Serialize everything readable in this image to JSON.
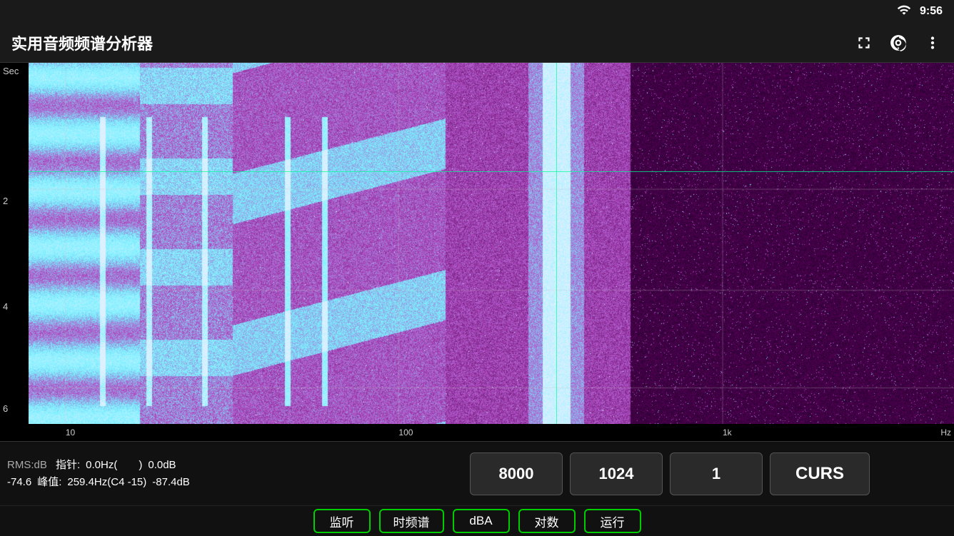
{
  "statusBar": {
    "time": "9:56"
  },
  "appBar": {
    "title": "实用音频频谱分析器",
    "icons": [
      "fullscreen",
      "target",
      "more-vert"
    ]
  },
  "spectrogram": {
    "yAxisLabel": "Sec",
    "yLabels": [
      {
        "value": "2",
        "topPercent": 36
      },
      {
        "value": "4",
        "topPercent": 64
      },
      {
        "value": "6",
        "topPercent": 91
      }
    ],
    "xLabels": [
      {
        "value": "10",
        "leftPercent": 4
      },
      {
        "value": "100",
        "leftPercent": 40
      },
      {
        "value": "1k",
        "leftPercent": 75
      },
      {
        "value": "Hz",
        "leftPercent": 96
      }
    ],
    "hLineTopPercent": 30,
    "vLineLeftPercent": 57
  },
  "infoBar": {
    "rmsLabel": "RMS:dB",
    "rmsValue": "-74.6",
    "pointerLabel": "指针:",
    "pointerFreq": "0.0Hz(",
    "pointerFreqSuffix": ")",
    "pointerDB": "0.0dB",
    "peakLabel": "峰值:",
    "peakFreq": "259.4Hz(C4 -15)",
    "peakDB": "-87.4dB",
    "buttons": {
      "btn1": "8000",
      "btn2": "1024",
      "btn3": "1",
      "btn4": "CURS"
    }
  },
  "bottomBar": {
    "buttons": [
      "监听",
      "时频谱",
      "dBA",
      "对数",
      "运行"
    ]
  }
}
